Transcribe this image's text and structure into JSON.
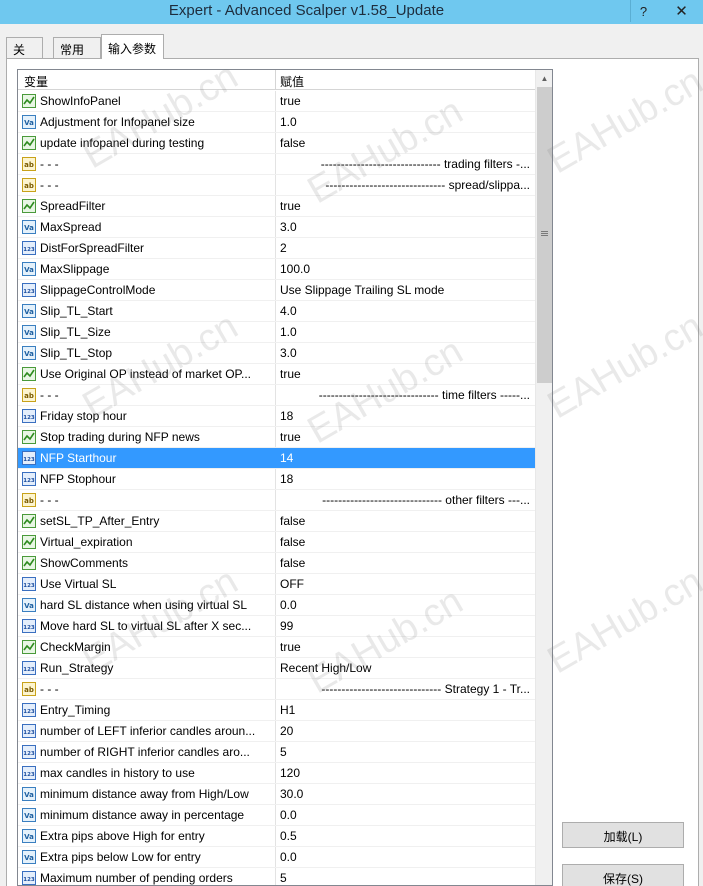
{
  "window": {
    "title": "Expert - Advanced Scalper v1.58_Update",
    "help_glyph": "?",
    "close_glyph": "✕"
  },
  "tabs": [
    {
      "label": "关于"
    },
    {
      "label": "常用"
    },
    {
      "label": "输入参数",
      "active": true
    }
  ],
  "grid": {
    "columns": [
      "变量",
      "赋值"
    ],
    "rows": [
      {
        "icon": "bool",
        "name": "ShowInfoPanel",
        "value": "true"
      },
      {
        "icon": "double",
        "name": "Adjustment for Infopanel size",
        "value": "1.0"
      },
      {
        "icon": "bool",
        "name": "update infopanel during testing",
        "value": "false"
      },
      {
        "icon": "string",
        "name": "- - -",
        "value": "------------------------------ trading filters -..."
      },
      {
        "icon": "string",
        "name": "- - -",
        "value": "------------------------------ spread/slippa..."
      },
      {
        "icon": "bool",
        "name": "SpreadFilter",
        "value": "true"
      },
      {
        "icon": "double",
        "name": "MaxSpread",
        "value": "3.0"
      },
      {
        "icon": "int",
        "name": "DistForSpreadFilter",
        "value": "2"
      },
      {
        "icon": "double",
        "name": "MaxSlippage",
        "value": "100.0"
      },
      {
        "icon": "int",
        "name": "SlippageControlMode",
        "value": "Use Slippage Trailing SL mode"
      },
      {
        "icon": "double",
        "name": "Slip_TL_Start",
        "value": "4.0"
      },
      {
        "icon": "double",
        "name": "Slip_TL_Size",
        "value": "1.0"
      },
      {
        "icon": "double",
        "name": "Slip_TL_Stop",
        "value": "3.0"
      },
      {
        "icon": "bool",
        "name": "Use Original OP instead of market OP...",
        "value": "true"
      },
      {
        "icon": "string",
        "name": "- - -",
        "value": "------------------------------ time filters -----..."
      },
      {
        "icon": "int",
        "name": "Friday stop hour",
        "value": "18"
      },
      {
        "icon": "bool",
        "name": "Stop trading during NFP news",
        "value": "true"
      },
      {
        "icon": "int",
        "name": "NFP Starthour",
        "value": "14",
        "selected": true
      },
      {
        "icon": "int",
        "name": "NFP Stophour",
        "value": "18"
      },
      {
        "icon": "string",
        "name": "- - -",
        "value": "------------------------------ other filters ---..."
      },
      {
        "icon": "bool",
        "name": "setSL_TP_After_Entry",
        "value": "false"
      },
      {
        "icon": "bool",
        "name": "Virtual_expiration",
        "value": "false"
      },
      {
        "icon": "bool",
        "name": "ShowComments",
        "value": "false"
      },
      {
        "icon": "int",
        "name": "Use Virtual SL",
        "value": "OFF"
      },
      {
        "icon": "double",
        "name": "hard SL distance when using virtual SL",
        "value": "0.0"
      },
      {
        "icon": "int",
        "name": "Move hard SL to virtual SL after X sec...",
        "value": "99"
      },
      {
        "icon": "bool",
        "name": "CheckMargin",
        "value": "true"
      },
      {
        "icon": "int",
        "name": "Run_Strategy",
        "value": "Recent High/Low"
      },
      {
        "icon": "string",
        "name": "- - -",
        "value": "------------------------------ Strategy 1 - Tr..."
      },
      {
        "icon": "int",
        "name": "Entry_Timing",
        "value": "H1"
      },
      {
        "icon": "int",
        "name": "number of LEFT inferior candles aroun...",
        "value": "20"
      },
      {
        "icon": "int",
        "name": "number of RIGHT inferior candles aro...",
        "value": "5"
      },
      {
        "icon": "int",
        "name": "max candles in history to use",
        "value": "120"
      },
      {
        "icon": "double",
        "name": "minimum distance away from High/Low",
        "value": "30.0"
      },
      {
        "icon": "double",
        "name": "minimum distance away in percentage",
        "value": "0.0"
      },
      {
        "icon": "double",
        "name": "Extra pips above High for entry",
        "value": "0.5"
      },
      {
        "icon": "double",
        "name": "Extra pips below Low for entry",
        "value": "0.0"
      },
      {
        "icon": "int",
        "name": "Maximum number of pending orders",
        "value": "5"
      }
    ]
  },
  "icon_labels": {
    "double": "Va",
    "int": "123",
    "string": "ab"
  },
  "buttons": {
    "load": "加载(L)",
    "save": "保存(S)"
  },
  "watermark": "EAHub.cn",
  "colors": {
    "titlebar": "#6fc8ef",
    "selection": "#3399ff"
  }
}
